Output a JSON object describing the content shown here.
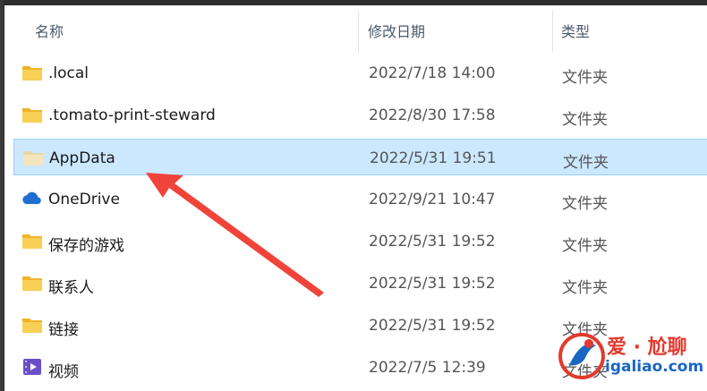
{
  "columns": {
    "name": "名称",
    "modified": "修改日期",
    "type": "类型"
  },
  "files": [
    {
      "name": ".local",
      "modified": "2022/7/18 14:00",
      "type": "文件夹",
      "icon": "folder-icon"
    },
    {
      "name": ".tomato-print-steward",
      "modified": "2022/8/30 17:58",
      "type": "文件夹",
      "icon": "folder-icon"
    },
    {
      "name": "AppData",
      "modified": "2022/5/31 19:51",
      "type": "文件夹",
      "icon": "folder-icon",
      "selected": true
    },
    {
      "name": "OneDrive",
      "modified": "2022/9/21 10:47",
      "type": "文件夹",
      "icon": "cloud-icon"
    },
    {
      "name": "保存的游戏",
      "modified": "2022/5/31 19:52",
      "type": "文件夹",
      "icon": "folder-icon"
    },
    {
      "name": "联系人",
      "modified": "2022/5/31 19:52",
      "type": "文件夹",
      "icon": "folder-icon"
    },
    {
      "name": "链接",
      "modified": "2022/5/31 19:52",
      "type": "文件夹",
      "icon": "folder-icon"
    },
    {
      "name": "视频",
      "modified": "2022/7/5 12:39",
      "type": "文件夹",
      "icon": "video-icon"
    }
  ],
  "watermark": {
    "title": "爱 · 尬聊",
    "url": "igaliao.com"
  },
  "colors": {
    "selection": "#cce8ff",
    "selection_border": "#99d1ff",
    "folder": "#f6c543",
    "arrow": "#f0443a"
  }
}
